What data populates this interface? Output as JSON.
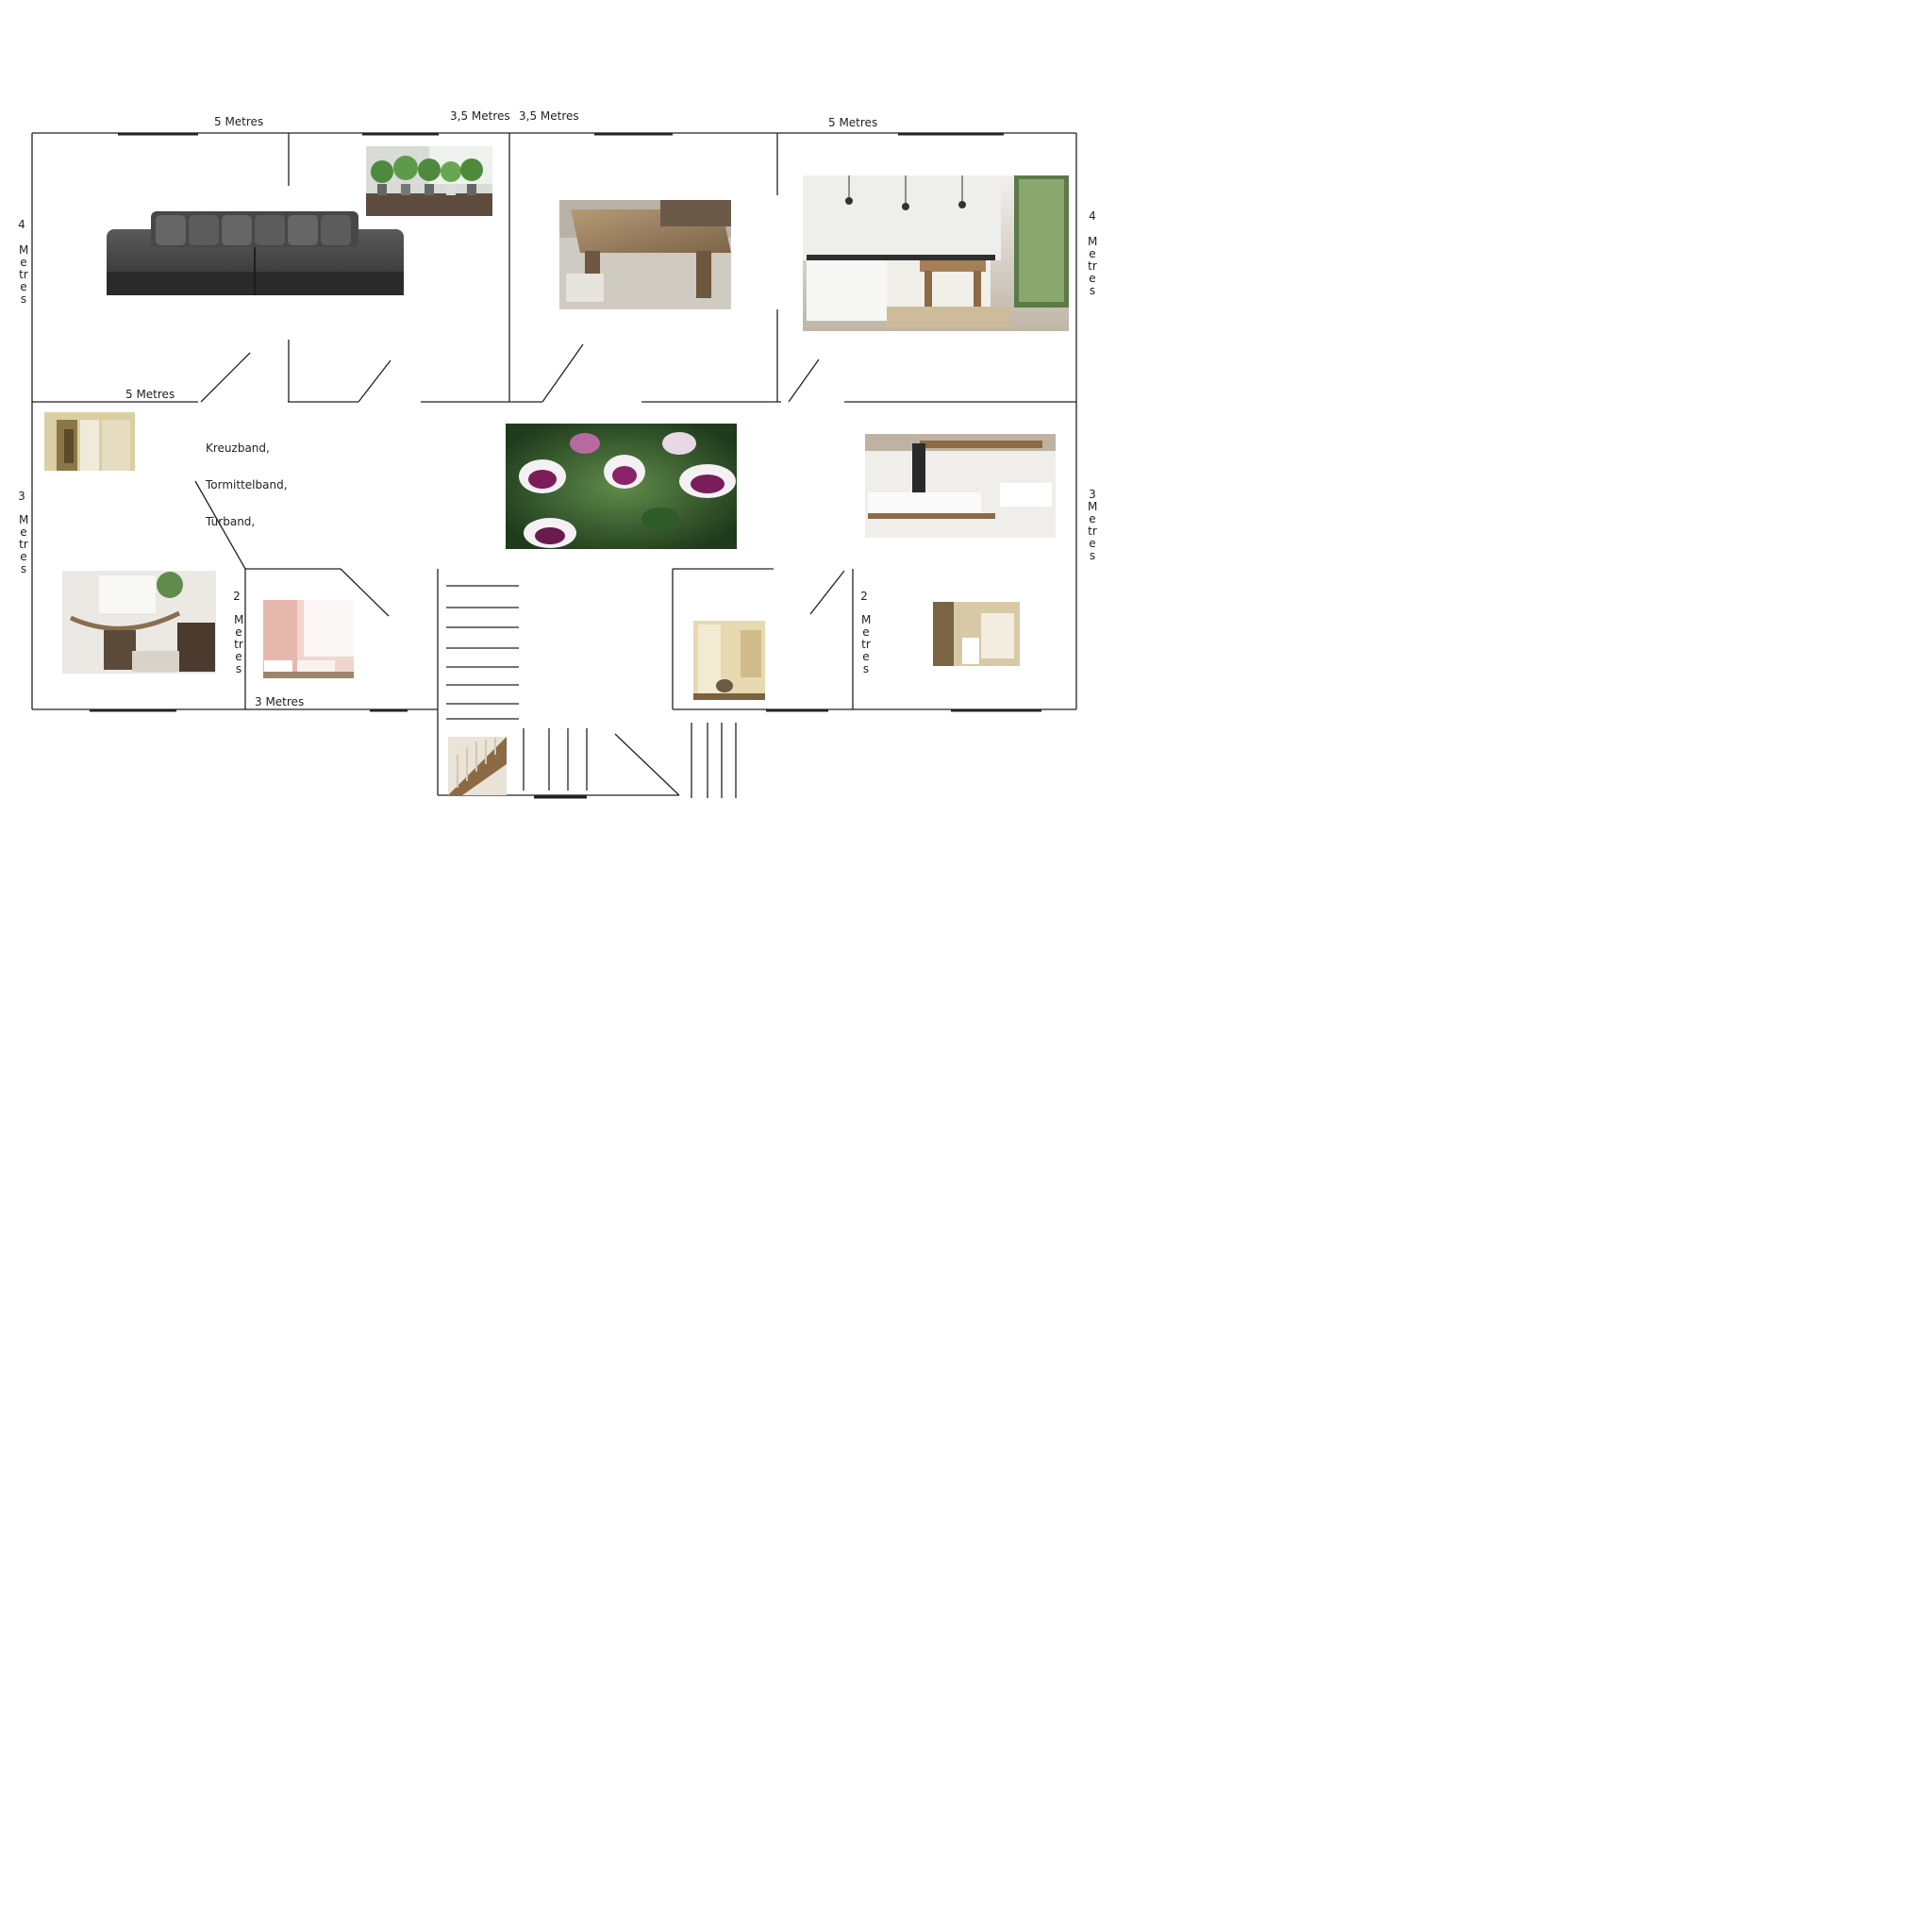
{
  "dimensions": {
    "top_left": "5 Metres",
    "top_mid_left": "3,5 Metres",
    "top_mid_right": "3,5 Metres",
    "top_right": "5 Metres",
    "living_bottom": "5 Metres",
    "left_upper_num": "4",
    "left_upper_word": "Metres",
    "left_lower_num": "3",
    "left_lower_word": "Metres",
    "right_upper_num": "4",
    "right_upper_word": "Metres",
    "right_lower": "3Metres",
    "small_room_left_num": "2",
    "small_room_left_word": "Metres",
    "small_room_bottom": "3 Metres",
    "bath_side_num": "2",
    "bath_side_word": "Metres"
  },
  "note": {
    "line1": "Kreuzband,",
    "line2": "Tormittelband,",
    "line3": "Türband,"
  },
  "photos": [
    "sofa-photo",
    "plants-photo",
    "dining-table-photo",
    "kitchen-photo",
    "wardrobe-photo",
    "flowers-photo",
    "bathroom-photo",
    "hammock-room-photo",
    "pink-room-photo",
    "toilet-photo",
    "washroom-photo",
    "staircase-photo"
  ],
  "colors": {
    "wall": "#222222",
    "background": "#ffffff"
  }
}
